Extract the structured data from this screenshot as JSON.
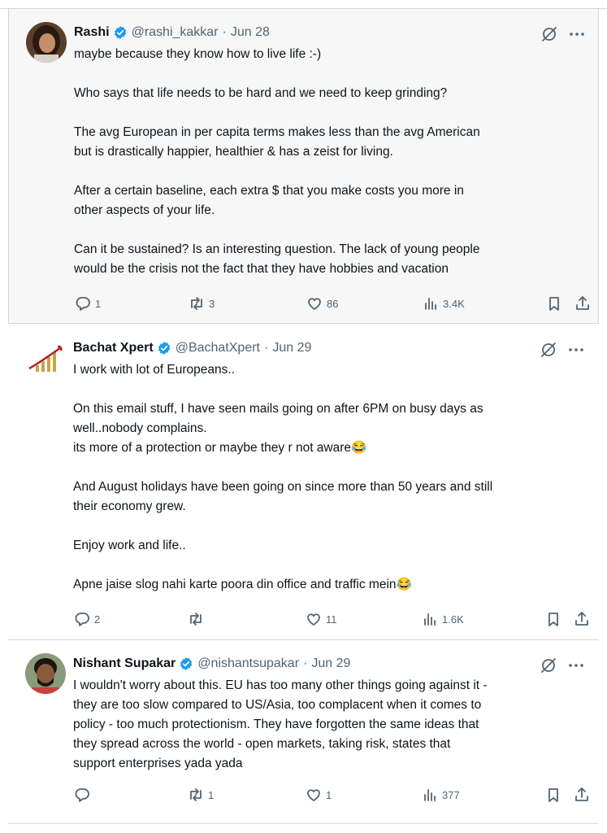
{
  "colors": {
    "verified": "#1d9bf0",
    "text": "#0f1419",
    "muted": "#536471",
    "border": "#cfd9de"
  },
  "tweets": [
    {
      "name": "Rashi",
      "handle": "@rashi_kakkar",
      "date": "Jun 28",
      "paragraphs": [
        "maybe because they know how to live life :-)",
        "",
        "Who says that life needs to be hard and we need to keep grinding?",
        "",
        "The avg European in per capita terms makes less than the avg American\nbut is drastically happier, healthier & has a zeist for living.",
        "",
        "After a certain baseline, each extra $ that you make costs you more in\nother aspects of your life.",
        "",
        "Can it be sustained? Is an interesting question. The lack of young people\nwould be the crisis not the fact that they have hobbies and vacation"
      ],
      "replies": "1",
      "reposts": "3",
      "likes": "86",
      "views": "3.4K"
    },
    {
      "name": "Bachat Xpert",
      "handle": "@BachatXpert",
      "date": "Jun 29",
      "paragraphs": [
        "I work with lot of Europeans..",
        "",
        "On this email stuff, I have seen mails going on after 6PM on busy days as\nwell..nobody complains.\nits more of a protection or maybe they r not aware😂",
        "",
        "And August holidays have been going on since more than 50 years and still\ntheir economy grew.",
        "",
        "Enjoy work and life..",
        "",
        "Apne jaise slog nahi karte poora din office and traffic mein😂"
      ],
      "replies": "2",
      "reposts": "",
      "likes": "11",
      "views": "1.6K"
    },
    {
      "name": "Nishant Supakar",
      "handle": "@nishantsupakar",
      "date": "Jun 29",
      "paragraphs": [
        "I wouldn't worry about this. EU has too many other things going against it -\nthey are too slow compared to US/Asia, too complacent when it comes to\npolicy - too much protectionism. They have forgotten the same ideas that\nthey spread across the world - open markets, taking risk, states that\nsupport enterprises yada yada"
      ],
      "replies": "",
      "reposts": "1",
      "likes": "1",
      "views": "377"
    }
  ]
}
